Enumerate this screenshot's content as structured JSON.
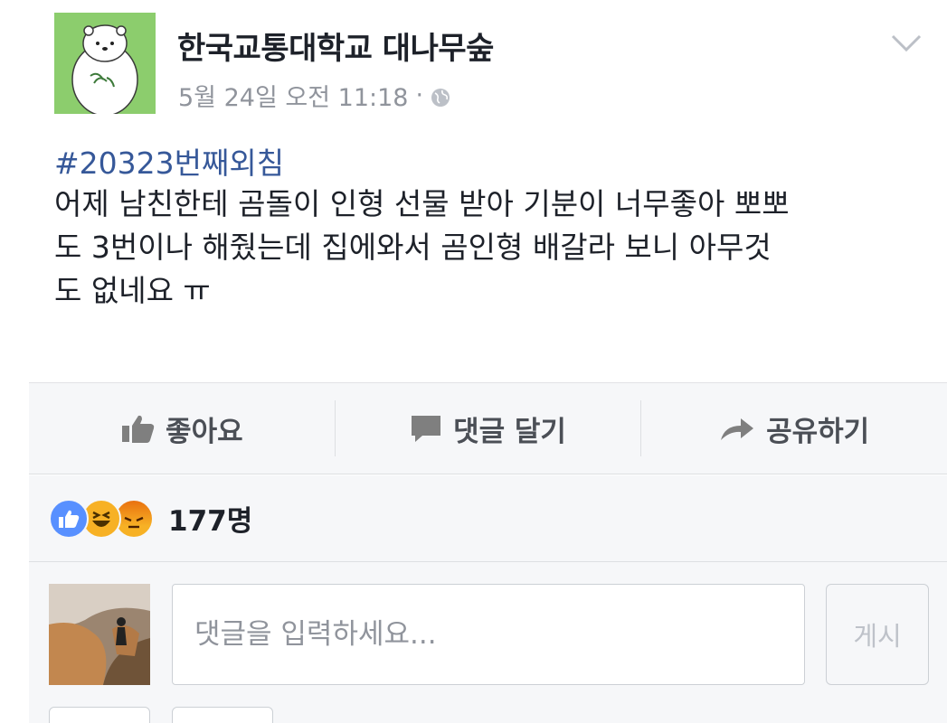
{
  "post": {
    "page_name": "한국교통대학교 대나무숲",
    "timestamp": "5월 24일 오전 11:18",
    "separator": "·",
    "privacy_icon": "globe-icon",
    "menu_icon": "chevron-down-icon",
    "hashtag": "#20323번째외침",
    "text": "어제 남친한테 곰돌이 인형 선물 받아 기분이 너무좋아 뽀뽀\n도 3번이나 해줬는데 집에와서 곰인형 배갈라 보니 아무것\n도 없네요 ㅠ"
  },
  "actions": {
    "like_label": "좋아요",
    "comment_label": "댓글 달기",
    "share_label": "공유하기"
  },
  "reactions": {
    "types": [
      "like",
      "haha",
      "angry"
    ],
    "count_label": "177명"
  },
  "comment_box": {
    "placeholder": "댓글을 입력하세요...",
    "post_label": "게시"
  },
  "colors": {
    "link": "#365899",
    "avatar_bg": "#8ccd6d",
    "like_blue": "#5890ff",
    "haha_yellow": "#f7b125",
    "muted_text": "#90949c"
  }
}
